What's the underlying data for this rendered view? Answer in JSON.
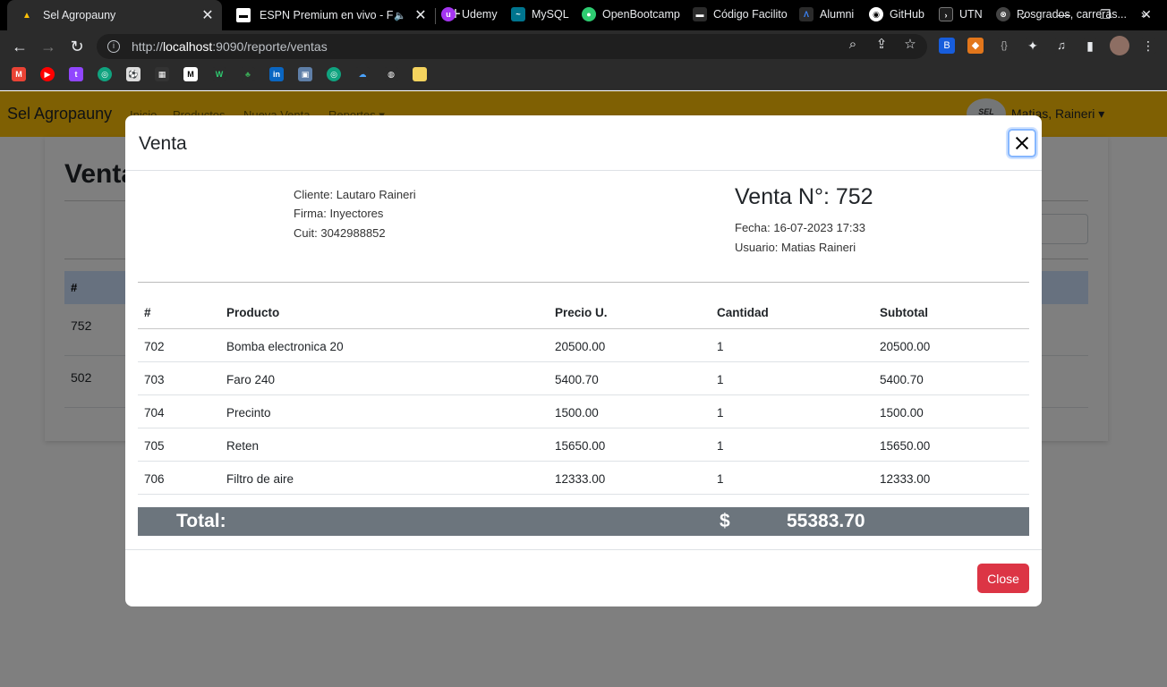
{
  "browser": {
    "tabs": [
      {
        "title": "Sel Agropauny",
        "favicon": "sel-favicon"
      },
      {
        "title": "ESPN Premium en vivo - Fútb",
        "favicon": "espn-favicon"
      }
    ],
    "close_glyph": "✕",
    "new_tab_glyph": "+",
    "speaker_glyph": "🔈",
    "url_scheme": "http://",
    "url_host": "localhost",
    "url_path": ":9090/reporte/ventas",
    "bookmarks": [
      {
        "label": "Udemy",
        "color": "#a435f0"
      },
      {
        "label": "MySQL",
        "color": "#00758f"
      },
      {
        "label": "OpenBootcamp",
        "color": "#2ecc71"
      },
      {
        "label": "Código Facilito",
        "color": "#444444"
      },
      {
        "label": "Alumni",
        "color": "#3b82f6"
      },
      {
        "label": "GitHub",
        "color": "#333333"
      },
      {
        "label": "UTN",
        "color": "#444444"
      },
      {
        "label": "Posgrados, carreras...",
        "color": "#555555"
      }
    ],
    "more_bookmarks": "»"
  },
  "app": {
    "brand": "Sel Agropauny",
    "nav": [
      "Inicio",
      "Productos",
      "Nueva Venta",
      "Reportes ▾"
    ],
    "user": "Matias, Raineri ▾",
    "avatar_text": "SEL",
    "page_heading": "Venta",
    "table_header": "#",
    "rows": [
      "752",
      "502"
    ]
  },
  "modal": {
    "title": "Venta",
    "cliente": "Cliente: Lautaro Raineri",
    "firma": "Firma: Inyectores",
    "cuit": "Cuit: 3042988852",
    "venta_num": "Venta N°: 752",
    "fecha": "Fecha: 16-07-2023 17:33",
    "usuario": "Usuario: Matias Raineri",
    "columns": [
      "#",
      "Producto",
      "Precio U.",
      "Cantidad",
      "Subtotal"
    ],
    "items": [
      {
        "id": "702",
        "producto": "Bomba electronica 20",
        "precio": "20500.00",
        "cantidad": "1",
        "subtotal": "20500.00"
      },
      {
        "id": "703",
        "producto": "Faro 240",
        "precio": "5400.70",
        "cantidad": "1",
        "subtotal": "5400.70"
      },
      {
        "id": "704",
        "producto": "Precinto",
        "precio": "1500.00",
        "cantidad": "1",
        "subtotal": "1500.00"
      },
      {
        "id": "705",
        "producto": "Reten",
        "precio": "15650.00",
        "cantidad": "1",
        "subtotal": "15650.00"
      },
      {
        "id": "706",
        "producto": "Filtro de aire",
        "precio": "12333.00",
        "cantidad": "1",
        "subtotal": "12333.00"
      }
    ],
    "total_label": "Total:",
    "currency": "$",
    "total_value": "55383.70",
    "close_button": "Close"
  },
  "colors": {
    "navbar": "#ffc107",
    "close_button": "#dc3545",
    "total_bar": "#6c757d",
    "table_header": "#cfe2ff"
  }
}
